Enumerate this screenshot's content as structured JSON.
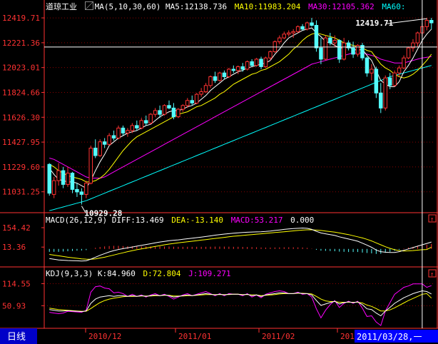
{
  "window": {
    "title": "道琼工业"
  },
  "price_header": {
    "indicator": "MA(5,10,30,60)",
    "items": [
      {
        "label": "MA5:",
        "value": "12138.736",
        "color": "#ffffff"
      },
      {
        "label": "MA10:",
        "value": "11983.204",
        "color": "#ffff00"
      },
      {
        "label": "MA30:",
        "value": "12105.362",
        "color": "#ff00ff"
      },
      {
        "label": "MA60:",
        "value": "",
        "color": "#00ffff"
      }
    ]
  },
  "macd_header": {
    "params": "MACD(26,12,9)",
    "diff": "DIFF:13.469",
    "dea": "DEA:-13.140",
    "macd": "MACD:53.217",
    "zero": "0.000"
  },
  "kdj_header": {
    "params": "KDJ(9,3,3)",
    "k": "K:84.960",
    "d": "D:72.804",
    "j": "J:109.271"
  },
  "footer": {
    "period": "日线",
    "cursor_date": "2011/03/28,一",
    "dates": [
      "2010/12",
      "2011/01",
      "2011/02",
      "201"
    ]
  },
  "colors": {
    "up": "#ff3232",
    "down": "#54fcfc",
    "ma5": "#ffffff",
    "ma10": "#ffff00",
    "ma30": "#ff00ff",
    "ma60": "#00ffff",
    "axis": "#ff3232",
    "grid": "#8b0000",
    "tick_text": "#ff3232"
  },
  "chart_data": {
    "type": "candlestick",
    "price_axis": {
      "ticks": [
        "12419.71",
        "12221.36",
        "12023.01",
        "11824.66",
        "11626.30",
        "11427.95",
        "11229.60",
        "11031.25"
      ],
      "range": [
        10870,
        12460
      ]
    },
    "annotations": [
      {
        "text": "10929.28",
        "value": 10929.28,
        "index": 7
      },
      {
        "text": "12419.71",
        "value": 12419.71,
        "index": 82
      }
    ],
    "ohlc": [
      [
        11250,
        11260,
        11000,
        11020
      ],
      [
        11010,
        11150,
        10980,
        11120
      ],
      [
        11120,
        11260,
        11080,
        11200
      ],
      [
        11200,
        11230,
        11060,
        11090
      ],
      [
        11090,
        11230,
        11070,
        11180
      ],
      [
        11180,
        11190,
        11020,
        11050
      ],
      [
        11050,
        11100,
        10990,
        11030
      ],
      [
        11030,
        11060,
        10929.28,
        11010
      ],
      [
        11010,
        11120,
        10980,
        11100
      ],
      [
        11100,
        11400,
        11090,
        11380
      ],
      [
        11380,
        11450,
        11300,
        11320
      ],
      [
        11320,
        11450,
        11310,
        11430
      ],
      [
        11430,
        11460,
        11380,
        11410
      ],
      [
        11410,
        11500,
        11400,
        11480
      ],
      [
        11480,
        11520,
        11440,
        11460
      ],
      [
        11460,
        11560,
        11450,
        11540
      ],
      [
        11540,
        11560,
        11480,
        11500
      ],
      [
        11500,
        11540,
        11470,
        11520
      ],
      [
        11520,
        11580,
        11500,
        11560
      ],
      [
        11560,
        11600,
        11520,
        11540
      ],
      [
        11540,
        11620,
        11530,
        11600
      ],
      [
        11600,
        11640,
        11560,
        11580
      ],
      [
        11580,
        11660,
        11570,
        11650
      ],
      [
        11650,
        11700,
        11630,
        11680
      ],
      [
        11680,
        11720,
        11620,
        11650
      ],
      [
        11650,
        11730,
        11640,
        11720
      ],
      [
        11720,
        11760,
        11690,
        11700
      ],
      [
        11700,
        11740,
        11610,
        11630
      ],
      [
        11630,
        11700,
        11620,
        11690
      ],
      [
        11690,
        11730,
        11670,
        11720
      ],
      [
        11720,
        11780,
        11700,
        11760
      ],
      [
        11760,
        11800,
        11720,
        11740
      ],
      [
        11740,
        11820,
        11730,
        11810
      ],
      [
        11810,
        11860,
        11790,
        11830
      ],
      [
        11830,
        11900,
        11820,
        11880
      ],
      [
        11880,
        11960,
        11860,
        11950
      ],
      [
        11950,
        11990,
        11900,
        11920
      ],
      [
        11920,
        11990,
        11910,
        11980
      ],
      [
        11980,
        12000,
        11930,
        11950
      ],
      [
        11950,
        12020,
        11940,
        12010
      ],
      [
        12010,
        12040,
        11980,
        12000
      ],
      [
        12000,
        12040,
        11970,
        12030
      ],
      [
        12030,
        12060,
        11990,
        12010
      ],
      [
        12010,
        12080,
        12000,
        12070
      ],
      [
        12070,
        12090,
        12030,
        12040
      ],
      [
        12040,
        12100,
        12030,
        12090
      ],
      [
        12090,
        12110,
        12010,
        12030
      ],
      [
        12030,
        12110,
        12020,
        12100
      ],
      [
        12100,
        12160,
        12080,
        12150
      ],
      [
        12150,
        12240,
        12140,
        12230
      ],
      [
        12230,
        12280,
        12210,
        12260
      ],
      [
        12260,
        12310,
        12250,
        12290
      ],
      [
        12290,
        12320,
        12270,
        12300
      ],
      [
        12300,
        12330,
        12260,
        12310
      ],
      [
        12310,
        12360,
        12300,
        12350
      ],
      [
        12350,
        12370,
        12320,
        12330
      ],
      [
        12330,
        12390,
        12320,
        12380
      ],
      [
        12380,
        12420,
        12350,
        12360
      ],
      [
        12360,
        12400,
        12150,
        12180
      ],
      [
        12180,
        12260,
        12050,
        12090
      ],
      [
        12090,
        12280,
        12080,
        12260
      ],
      [
        12260,
        12300,
        12200,
        12220
      ],
      [
        12220,
        12280,
        12190,
        12240
      ],
      [
        12240,
        12250,
        12060,
        12090
      ],
      [
        12090,
        12260,
        12080,
        12220
      ],
      [
        12220,
        12240,
        12160,
        12180
      ],
      [
        12180,
        12230,
        12100,
        12130
      ],
      [
        12130,
        12210,
        12110,
        12200
      ],
      [
        12200,
        12220,
        12080,
        12100
      ],
      [
        12100,
        12110,
        11950,
        11980
      ],
      [
        11980,
        12050,
        11920,
        12010
      ],
      [
        12010,
        12030,
        11780,
        11820
      ],
      [
        11820,
        11900,
        11660,
        11700
      ],
      [
        11700,
        11960,
        11680,
        11940
      ],
      [
        11940,
        11980,
        11850,
        11880
      ],
      [
        11880,
        12000,
        11870,
        11980
      ],
      [
        11980,
        12040,
        11950,
        12020
      ],
      [
        12020,
        12120,
        12010,
        12100
      ],
      [
        12100,
        12190,
        12090,
        12180
      ],
      [
        12180,
        12250,
        12150,
        12220
      ],
      [
        12220,
        12310,
        12190,
        12300
      ],
      [
        12300,
        12380,
        12270,
        12350
      ],
      [
        12350,
        12419.71,
        12320,
        12400
      ],
      [
        12400,
        12420,
        12330,
        12380
      ]
    ],
    "ma_values": {
      "ma5": [
        11220,
        11170,
        11130,
        11120,
        11110,
        11110,
        11100,
        11080,
        11060,
        11120,
        11200,
        11270,
        11330,
        11400,
        11430,
        11460,
        11480,
        11500,
        11510,
        11520,
        11540,
        11560,
        11570,
        11600,
        11630,
        11650,
        11670,
        11680,
        11680,
        11690,
        11710,
        11720,
        11740,
        11770,
        11800,
        11840,
        11870,
        11900,
        11930,
        11950,
        11970,
        11990,
        12000,
        12020,
        12030,
        12040,
        12050,
        12060,
        12080,
        12130,
        12170,
        12220,
        12260,
        12280,
        12300,
        12320,
        12330,
        12340,
        12300,
        12270,
        12230,
        12220,
        12200,
        12180,
        12180,
        12190,
        12170,
        12160,
        12170,
        12120,
        12080,
        12000,
        11920,
        11890,
        11870,
        11870,
        11910,
        11990,
        12040,
        12100,
        12170,
        12240,
        12290,
        12330
      ],
      "ma10": [
        11250,
        11230,
        11200,
        11180,
        11160,
        11150,
        11140,
        11130,
        11110,
        11110,
        11120,
        11140,
        11170,
        11210,
        11260,
        11310,
        11360,
        11400,
        11440,
        11470,
        11490,
        11510,
        11530,
        11550,
        11570,
        11590,
        11610,
        11630,
        11650,
        11660,
        11670,
        11690,
        11710,
        11720,
        11740,
        11760,
        11780,
        11810,
        11830,
        11860,
        11890,
        11910,
        11930,
        11950,
        11970,
        11980,
        12000,
        12010,
        12030,
        12050,
        12070,
        12100,
        12130,
        12170,
        12200,
        12240,
        12270,
        12290,
        12300,
        12290,
        12280,
        12270,
        12260,
        12240,
        12220,
        12210,
        12200,
        12190,
        12180,
        12160,
        12150,
        12100,
        12050,
        12020,
        12000,
        11970,
        11950,
        11940,
        11950,
        11970,
        12000,
        12040,
        12080,
        12130
      ],
      "ma30": [
        11300,
        11290,
        11270,
        11250,
        11230,
        11210,
        11190,
        11170,
        11150,
        11140,
        11140,
        11140,
        11150,
        11170,
        11190,
        11210,
        11230,
        11250,
        11270,
        11290,
        11310,
        11330,
        11350,
        11370,
        11390,
        11410,
        11430,
        11450,
        11470,
        11490,
        11510,
        11530,
        11550,
        11570,
        11590,
        11610,
        11630,
        11650,
        11670,
        11690,
        11710,
        11730,
        11750,
        11770,
        11790,
        11810,
        11830,
        11850,
        11870,
        11890,
        11910,
        11930,
        11950,
        11970,
        11990,
        12010,
        12030,
        12050,
        12060,
        12070,
        12080,
        12090,
        12100,
        12110,
        12120,
        12130,
        12140,
        12140,
        12140,
        12130,
        12120,
        12110,
        12090,
        12080,
        12070,
        12060,
        12060,
        12060,
        12070,
        12080,
        12090,
        12100,
        12105,
        12110
      ],
      "ma60": [
        10880,
        10890,
        10900,
        10910,
        10920,
        10930,
        10940,
        10950,
        10960,
        10975,
        10990,
        11005,
        11020,
        11035,
        11050,
        11065,
        11080,
        11095,
        11110,
        11125,
        11140,
        11155,
        11170,
        11185,
        11200,
        11215,
        11230,
        11245,
        11260,
        11275,
        11290,
        11305,
        11320,
        11335,
        11350,
        11365,
        11380,
        11395,
        11410,
        11425,
        11440,
        11455,
        11470,
        11485,
        11500,
        11515,
        11530,
        11545,
        11560,
        11575,
        11590,
        11605,
        11620,
        11635,
        11650,
        11665,
        11680,
        11695,
        11710,
        11725,
        11740,
        11755,
        11770,
        11785,
        11800,
        11815,
        11830,
        11845,
        11860,
        11875,
        11890,
        11905,
        11920,
        11935,
        11950,
        11960,
        11970,
        11980,
        11990,
        12000,
        12010,
        12020,
        12030,
        12040
      ]
    },
    "macd": {
      "axis_ticks": [
        "154.42",
        "13.36"
      ],
      "range": [
        -110,
        170
      ],
      "diff": [
        -70,
        -75,
        -80,
        -82,
        -84,
        -85,
        -86,
        -88,
        -86,
        -74,
        -60,
        -46,
        -34,
        -22,
        -12,
        -4,
        2,
        8,
        14,
        20,
        26,
        32,
        38,
        44,
        50,
        55,
        60,
        63,
        66,
        70,
        74,
        78,
        82,
        86,
        90,
        95,
        100,
        104,
        108,
        111,
        114,
        117,
        119,
        121,
        123,
        124,
        125,
        127,
        130,
        134,
        138,
        142,
        145,
        148,
        150,
        152,
        150,
        142,
        128,
        116,
        110,
        104,
        98,
        88,
        80,
        72,
        64,
        56,
        42,
        28,
        12,
        -8,
        -20,
        -24,
        -26,
        -26,
        -20,
        -10,
        0,
        10,
        20,
        30,
        40,
        50
      ],
      "dea": [
        -40,
        -45,
        -50,
        -55,
        -60,
        -64,
        -68,
        -72,
        -74,
        -75,
        -72,
        -66,
        -60,
        -52,
        -44,
        -36,
        -28,
        -20,
        -13,
        -6,
        0,
        6,
        12,
        18,
        24,
        30,
        35,
        40,
        44,
        48,
        52,
        56,
        60,
        64,
        68,
        72,
        76,
        80,
        84,
        88,
        92,
        95,
        98,
        101,
        104,
        107,
        110,
        113,
        116,
        119,
        122,
        125,
        128,
        131,
        134,
        137,
        139,
        139,
        137,
        134,
        130,
        126,
        122,
        116,
        110,
        104,
        96,
        88,
        80,
        70,
        58,
        44,
        30,
        16,
        4,
        -6,
        -12,
        -15,
        -14,
        -12,
        -9,
        -6,
        -4,
        13
      ],
      "hist": [
        -60,
        -60,
        -60,
        -54,
        -48,
        -42,
        -36,
        -32,
        -24,
        2,
        24,
        40,
        52,
        60,
        64,
        64,
        60,
        56,
        54,
        52,
        52,
        52,
        52,
        52,
        52,
        50,
        50,
        46,
        44,
        44,
        44,
        44,
        44,
        44,
        44,
        46,
        48,
        48,
        48,
        46,
        44,
        44,
        42,
        40,
        38,
        34,
        30,
        28,
        28,
        30,
        32,
        34,
        34,
        34,
        32,
        30,
        22,
        6,
        -18,
        -36,
        -40,
        -44,
        -48,
        -56,
        -60,
        -64,
        -64,
        -64,
        -76,
        -84,
        -92,
        -104,
        -100,
        -80,
        -60,
        -40,
        -16,
        10,
        28,
        44,
        58,
        72,
        88,
        104
      ]
    },
    "kdj": {
      "axis_ticks": [
        "114.55",
        "50.93"
      ],
      "range": [
        -10,
        130
      ],
      "k": [
        40,
        38,
        36,
        36,
        37,
        36,
        35,
        34,
        36,
        58,
        70,
        76,
        78,
        80,
        78,
        80,
        80,
        78,
        80,
        78,
        80,
        78,
        80,
        82,
        80,
        82,
        80,
        76,
        78,
        80,
        82,
        80,
        82,
        84,
        86,
        84,
        82,
        84,
        82,
        84,
        84,
        84,
        82,
        84,
        80,
        82,
        78,
        82,
        84,
        86,
        88,
        88,
        86,
        86,
        88,
        86,
        86,
        82,
        66,
        52,
        56,
        60,
        64,
        56,
        60,
        62,
        60,
        62,
        54,
        42,
        40,
        30,
        22,
        36,
        46,
        58,
        66,
        74,
        80,
        86,
        90,
        94,
        92,
        85
      ],
      "d": [
        44,
        42,
        40,
        39,
        38,
        37,
        36,
        35,
        35,
        43,
        52,
        60,
        66,
        70,
        73,
        75,
        77,
        78,
        78,
        78,
        79,
        79,
        79,
        80,
        80,
        81,
        81,
        79,
        79,
        79,
        80,
        80,
        81,
        82,
        83,
        83,
        83,
        83,
        83,
        83,
        84,
        84,
        83,
        83,
        82,
        82,
        80,
        81,
        82,
        83,
        85,
        86,
        86,
        86,
        87,
        87,
        86,
        85,
        78,
        70,
        65,
        63,
        63,
        61,
        61,
        61,
        61,
        61,
        59,
        53,
        49,
        43,
        36,
        36,
        39,
        45,
        52,
        59,
        66,
        72,
        78,
        84,
        86,
        73
      ],
      "j": [
        32,
        30,
        28,
        30,
        35,
        34,
        33,
        32,
        38,
        90,
        106,
        108,
        102,
        100,
        88,
        90,
        86,
        78,
        84,
        78,
        82,
        76,
        82,
        86,
        80,
        84,
        78,
        70,
        76,
        82,
        86,
        80,
        84,
        88,
        92,
        86,
        80,
        86,
        80,
        86,
        84,
        84,
        80,
        86,
        76,
        82,
        74,
        84,
        88,
        92,
        94,
        92,
        86,
        86,
        90,
        84,
        86,
        76,
        42,
        16,
        38,
        54,
        66,
        46,
        58,
        64,
        58,
        64,
        44,
        20,
        22,
        4,
        -6,
        36,
        60,
        84,
        94,
        104,
        108,
        114,
        114,
        114,
        104,
        109
      ]
    }
  }
}
